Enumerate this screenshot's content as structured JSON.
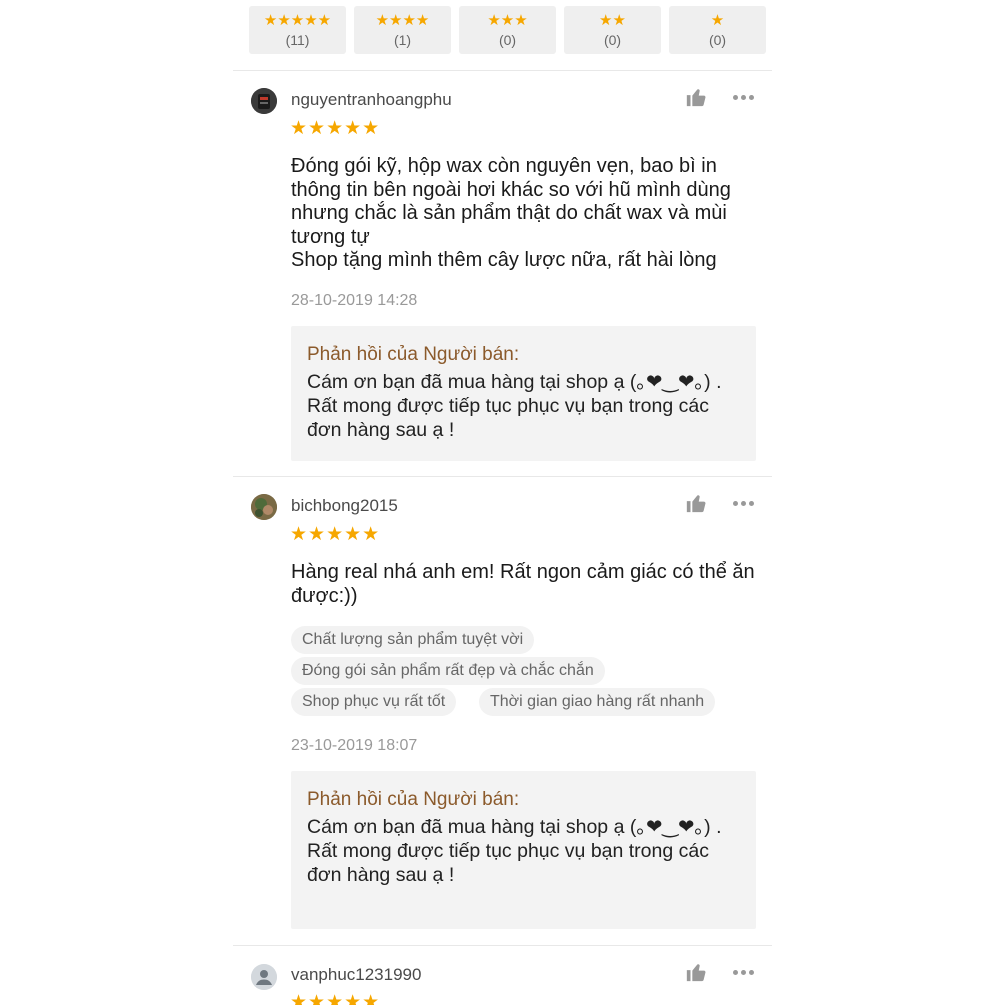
{
  "filters": [
    {
      "stars": "★★★★★",
      "count": "(11)"
    },
    {
      "stars": "★★★★",
      "count": "(1)"
    },
    {
      "stars": "★★★",
      "count": "(0)"
    },
    {
      "stars": "★★",
      "count": "(0)"
    },
    {
      "stars": "★",
      "count": "(0)"
    }
  ],
  "reviews": [
    {
      "username": "nguyentranhoangphu",
      "rating": 5,
      "stars": "★★★★★",
      "text": "Đóng gói kỹ, hộp wax còn nguyên vẹn, bao bì in\nthông tin bên ngoài hơi khác so với hũ mình dùng\nnhưng chắc là sản phẩm thật do chất wax và mùi\ntương tự\nShop tặng mình thêm cây lược nữa, rất hài lòng",
      "date": "28-10-2019 14:28",
      "reply_title": "Phản hồi của Người bán:",
      "reply_text": "Cám ơn bạn đã mua hàng tại shop ạ (｡❤‿❤｡) .\nRất mong được tiếp tục phục vụ bạn trong các\nđơn hàng sau ạ !"
    },
    {
      "username": "bichbong2015",
      "rating": 5,
      "stars": "★★★★★",
      "text": "Hàng real nhá anh em! Rất ngon cảm giác có thể ăn\nđược:))",
      "tags": [
        "Chất lượng sản phẩm tuyệt vời",
        "Đóng gói sản phẩm rất đẹp và chắc chắn",
        "Shop phục vụ rất tốt",
        "Thời gian giao hàng rất nhanh"
      ],
      "date": "23-10-2019 18:07",
      "reply_title": "Phản hồi của Người bán:",
      "reply_text": "Cám ơn bạn đã mua hàng tại shop ạ (｡❤‿❤｡) .\nRất mong được tiếp tục phục vụ bạn trong các\nđơn hàng sau ạ !"
    },
    {
      "username": "vanphuc1231990",
      "rating": 5,
      "stars": "★★★★★"
    }
  ],
  "colors": {
    "star": "#f6a700",
    "reply_title": "#8b5a2b",
    "muted": "#999999",
    "chip_bg": "#f2f2f2"
  },
  "icons": {
    "like": "thumbs-up-icon",
    "more": "more-dots-icon",
    "default_avatar": "user-icon"
  }
}
